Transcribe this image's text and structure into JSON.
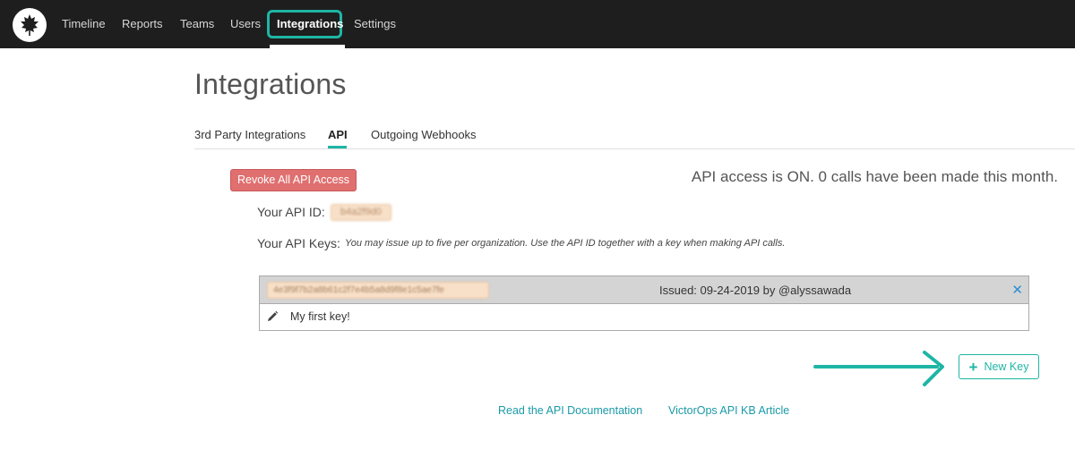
{
  "nav": {
    "items": [
      {
        "label": "Timeline"
      },
      {
        "label": "Reports"
      },
      {
        "label": "Teams"
      },
      {
        "label": "Users"
      },
      {
        "label": "Integrations",
        "active": true
      },
      {
        "label": "Settings"
      }
    ]
  },
  "page": {
    "title": "Integrations",
    "tabs": [
      {
        "label": "3rd Party Integrations"
      },
      {
        "label": "API",
        "active": true
      },
      {
        "label": "Outgoing Webhooks"
      }
    ]
  },
  "api": {
    "revoke_label": "Revoke All API Access",
    "status": "API access is ON. 0 calls have been made this month.",
    "id_label": "Your API ID:",
    "id_value": "b4a2f9d0",
    "keys_label": "Your API Keys:",
    "keys_note": "You may issue up to five per organization. Use the API ID together with a key when making API calls.",
    "keys": [
      {
        "value": "4e3f9f7b2a8b61c2f7e4b5a8d9f8e1c5ae7fe",
        "issued": "Issued: 09-24-2019 by @alyssawada",
        "name": "My first key!"
      }
    ],
    "new_key_label": "New Key"
  },
  "links": {
    "docs": "Read the API Documentation",
    "kb": "VictorOps API KB Article"
  },
  "colors": {
    "accent": "#1fb5a5",
    "danger": "#e06f6f",
    "nav_bg": "#1e1e1e"
  }
}
